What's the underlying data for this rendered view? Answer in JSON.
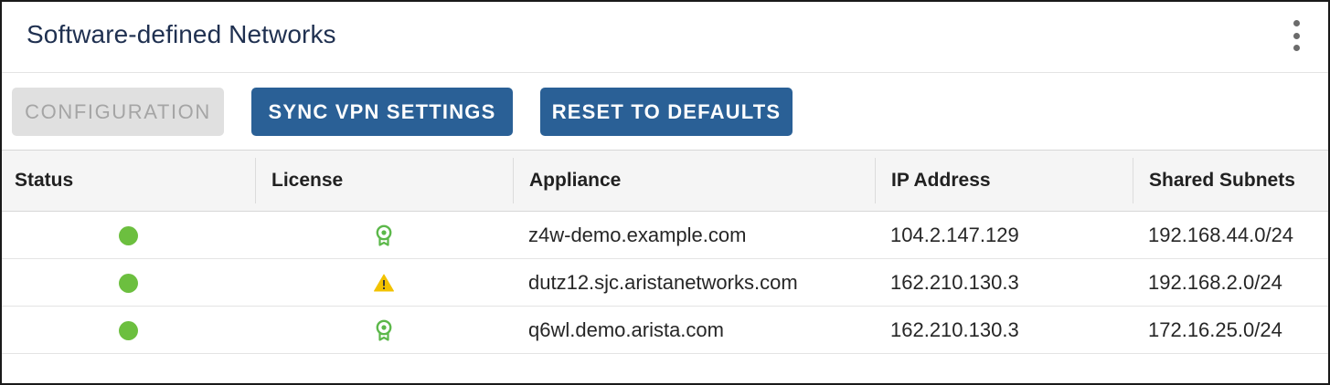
{
  "panel": {
    "title": "Software-defined Networks",
    "menu_icon": "kebab-vertical-icon"
  },
  "toolbar": {
    "configuration_label": "CONFIGURATION",
    "sync_label": "SYNC VPN SETTINGS",
    "reset_label": "RESET TO DEFAULTS"
  },
  "colors": {
    "primary_button": "#2a6096",
    "disabled_button": "#e0e0e0",
    "status_ok": "#6cbf3f",
    "license_ok": "#5cb84a",
    "license_warning": "#f2c200",
    "title": "#1f3050"
  },
  "table": {
    "columns": [
      "Status",
      "License",
      "Appliance",
      "IP Address",
      "Shared Subnets"
    ],
    "rows": [
      {
        "status": "online",
        "status_icon": "green-dot-icon",
        "license": "valid",
        "license_icon": "license-badge-icon",
        "appliance": "z4w-demo.example.com",
        "ip": "104.2.147.129",
        "subnet": "192.168.44.0/24"
      },
      {
        "status": "online",
        "status_icon": "green-dot-icon",
        "license": "warning",
        "license_icon": "warning-triangle-icon",
        "appliance": "dutz12.sjc.aristanetworks.com",
        "ip": "162.210.130.3",
        "subnet": "192.168.2.0/24"
      },
      {
        "status": "online",
        "status_icon": "green-dot-icon",
        "license": "valid",
        "license_icon": "license-badge-icon",
        "appliance": "q6wl.demo.arista.com",
        "ip": "162.210.130.3",
        "subnet": "172.16.25.0/24"
      }
    ]
  }
}
